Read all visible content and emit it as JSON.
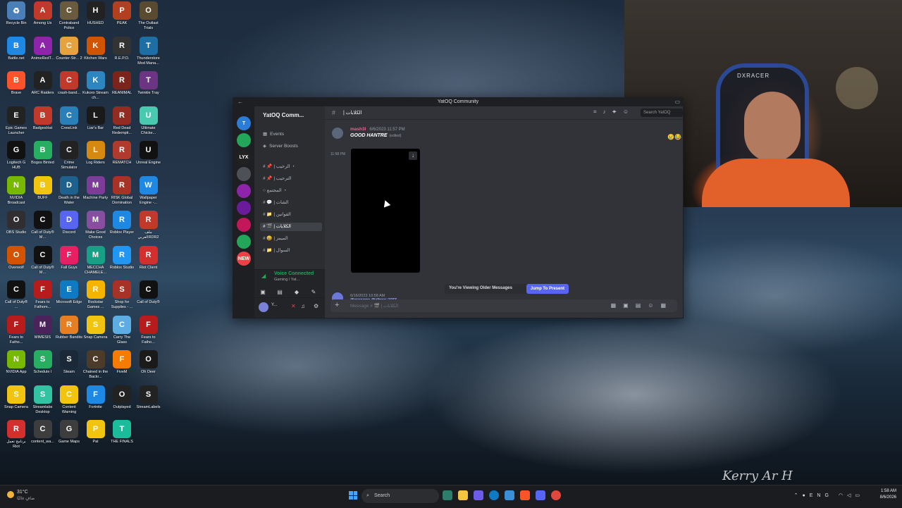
{
  "desktop": {
    "icons": [
      {
        "label": "Recycle Bin",
        "color": "#4b7fb8",
        "glyph": "♻"
      },
      {
        "label": "Among Us",
        "color": "#c0392b",
        "glyph": "A"
      },
      {
        "label": "Contraband Police",
        "color": "#6b5b3e",
        "glyph": "C"
      },
      {
        "label": "HUSHED",
        "color": "#222",
        "glyph": "H"
      },
      {
        "label": "PEAK",
        "color": "#b24020",
        "glyph": "P"
      },
      {
        "label": "The Outlast Trials",
        "color": "#5a4a30",
        "glyph": "O"
      },
      {
        "label": "Battle.net",
        "color": "#1e88e5",
        "glyph": "B"
      },
      {
        "label": "AnimeRedT...",
        "color": "#8e24aa",
        "glyph": "A"
      },
      {
        "label": "Counter-Str... 2",
        "color": "#e6a23c",
        "glyph": "C"
      },
      {
        "label": "Kitchen Wars",
        "color": "#d35400",
        "glyph": "K"
      },
      {
        "label": "R.E.P.O.",
        "color": "#333",
        "glyph": "R"
      },
      {
        "label": "Thunderstore Mod Mana...",
        "color": "#1c6ea4",
        "glyph": "T"
      },
      {
        "label": "Brave",
        "color": "#fb542b",
        "glyph": "B"
      },
      {
        "label": "ARC Raiders",
        "color": "#222",
        "glyph": "A"
      },
      {
        "label": "crash-band...",
        "color": "#c0392b",
        "glyph": "C"
      },
      {
        "label": "Kukoro Stream ch...",
        "color": "#2e86c1",
        "glyph": "K"
      },
      {
        "label": "REANIMAL",
        "color": "#7b241c",
        "glyph": "R"
      },
      {
        "label": "Twinkle Tray",
        "color": "#6c3483",
        "glyph": "T"
      },
      {
        "label": "Epic Games Launcher",
        "color": "#222",
        "glyph": "E"
      },
      {
        "label": "BadgesHat",
        "color": "#c0392b",
        "glyph": "B"
      },
      {
        "label": "CrewLink",
        "color": "#2980b9",
        "glyph": "C"
      },
      {
        "label": "Liar's Bar",
        "color": "#1a1a1a",
        "glyph": "L"
      },
      {
        "label": "Red Dead Redempti...",
        "color": "#922b21",
        "glyph": "R"
      },
      {
        "label": "Ultimate Chicke...",
        "color": "#48c9b0",
        "glyph": "U"
      },
      {
        "label": "Logitech G HUB",
        "color": "#111",
        "glyph": "G"
      },
      {
        "label": "Bogos Binted",
        "color": "#27ae60",
        "glyph": "B"
      },
      {
        "label": "Crime Simulator",
        "color": "#222",
        "glyph": "C"
      },
      {
        "label": "Log Riders",
        "color": "#d68910",
        "glyph": "L"
      },
      {
        "label": "REMATCH",
        "color": "#b03a2e",
        "glyph": "R"
      },
      {
        "label": "Unreal Engine",
        "color": "#111",
        "glyph": "U"
      },
      {
        "label": "NVIDIA Broadcast",
        "color": "#76b900",
        "glyph": "N"
      },
      {
        "label": "BUFF",
        "color": "#f1c40f",
        "glyph": "B"
      },
      {
        "label": "Death in the Water",
        "color": "#1f618d",
        "glyph": "D"
      },
      {
        "label": "Machine Party",
        "color": "#7d3c98",
        "glyph": "M"
      },
      {
        "label": "RISK Global Domination",
        "color": "#a93226",
        "glyph": "R"
      },
      {
        "label": "Wallpaper Engine -...",
        "color": "#1e88e5",
        "glyph": "W"
      },
      {
        "label": "OBS Studio",
        "color": "#302e31",
        "glyph": "O"
      },
      {
        "label": "Call of Duty® M...",
        "color": "#111",
        "glyph": "C"
      },
      {
        "label": "Discord",
        "color": "#5865f2",
        "glyph": "D"
      },
      {
        "label": "Make Good Choices",
        "color": "#884ea0",
        "glyph": "M"
      },
      {
        "label": "Roblox Player",
        "color": "#1e88e5",
        "glyph": "R"
      },
      {
        "label": "ملف العربيRDR2",
        "color": "#c0392b",
        "glyph": "R"
      },
      {
        "label": "Overwolf",
        "color": "#d35400",
        "glyph": "O"
      },
      {
        "label": "Call of Duty® M...",
        "color": "#111",
        "glyph": "C"
      },
      {
        "label": "Fall Guys",
        "color": "#e91e63",
        "glyph": "F"
      },
      {
        "label": "MECCHA CHAMELE...",
        "color": "#16a085",
        "glyph": "M"
      },
      {
        "label": "Roblox Studio",
        "color": "#2196f3",
        "glyph": "R"
      },
      {
        "label": "Riot Client",
        "color": "#d32f2f",
        "glyph": "R"
      },
      {
        "label": "Call of Duty® ...",
        "color": "#111",
        "glyph": "C"
      },
      {
        "label": "Fears to Fathom...",
        "color": "#b71c1c",
        "glyph": "F"
      },
      {
        "label": "Microsoft Edge",
        "color": "#0e7ac4",
        "glyph": "E"
      },
      {
        "label": "Rockstar Games ...",
        "color": "#f4b400",
        "glyph": "R"
      },
      {
        "label": "Shop for Supplies - ...",
        "color": "#a93226",
        "glyph": "S"
      },
      {
        "label": "Call of Duty®",
        "color": "#111",
        "glyph": "C"
      },
      {
        "label": "Fears to Fatho...",
        "color": "#b71c1c",
        "glyph": "F"
      },
      {
        "label": "MIMESIS",
        "color": "#4a235a",
        "glyph": "M"
      },
      {
        "label": "Rubber Bandits",
        "color": "#e67e22",
        "glyph": "R"
      },
      {
        "label": "Snap Camera",
        "color": "#f1c40f",
        "glyph": "S"
      },
      {
        "label": "Carry The Glass",
        "color": "#5dade2",
        "glyph": "C"
      },
      {
        "label": "Fears to Fatho...",
        "color": "#b71c1c",
        "glyph": "F"
      },
      {
        "label": "NVIDIA App",
        "color": "#76b900",
        "glyph": "N"
      },
      {
        "label": "Schedule I",
        "color": "#27ae60",
        "glyph": "S"
      },
      {
        "label": "Steam",
        "color": "#1b2838",
        "glyph": "S"
      },
      {
        "label": "Chained in the Backr...",
        "color": "#4d3b2a",
        "glyph": "C"
      },
      {
        "label": "FiveM",
        "color": "#f57c00",
        "glyph": "F"
      },
      {
        "label": "Oh Deer",
        "color": "#1a1a1a",
        "glyph": "O"
      },
      {
        "label": "Snap Camera",
        "color": "#f1c40f",
        "glyph": "S"
      },
      {
        "label": "Streamlabs Desktop",
        "color": "#31c3a2",
        "glyph": "S"
      },
      {
        "label": "Content Warning",
        "color": "#f1c40f",
        "glyph": "C"
      },
      {
        "label": "Fortnite",
        "color": "#1e88e5",
        "glyph": "F"
      },
      {
        "label": "Outplayed",
        "color": "#222",
        "glyph": "O"
      },
      {
        "label": "StreamLabels",
        "color": "#222",
        "glyph": "S"
      },
      {
        "label": "برنامج تعمل Riot",
        "color": "#d32f2f",
        "glyph": "R"
      },
      {
        "label": "content_wa...",
        "color": "#3d3d3d",
        "glyph": "C"
      },
      {
        "label": "Game Maps",
        "color": "#3d3d3d",
        "glyph": "G"
      },
      {
        "label": "Pal",
        "color": "#f1c40f",
        "glyph": "P"
      },
      {
        "label": "THE FINALS",
        "color": "#1abc9c",
        "glyph": "T"
      }
    ]
  },
  "webcam": {
    "chair_brand": "DXRACER"
  },
  "discord": {
    "window_title": "YatOQ Community",
    "server_name": "YatOQ Comm...",
    "servers": [
      {
        "label": "T",
        "color": "#2b7bd9"
      },
      {
        "label": "",
        "color": "#23a55a"
      },
      {
        "label": "LYX",
        "color": "#222"
      },
      {
        "label": "",
        "color": "#4e5058"
      },
      {
        "label": "",
        "color": "#8e24aa"
      },
      {
        "label": "",
        "color": "#6a1b9a"
      },
      {
        "label": "",
        "color": "#c2185b"
      },
      {
        "label": "",
        "color": "#23a55a"
      },
      {
        "label": "NEW",
        "color": "#ed4245"
      }
    ],
    "channel_items": [
      {
        "label": "Events",
        "icon": "▦"
      },
      {
        "label": "Server Boosts",
        "icon": "◈"
      },
      {
        "label": "# 📌 | الرحيب ・",
        "icon": ""
      },
      {
        "label": "# 📌 | الترحيب",
        "icon": ""
      },
      {
        "label": "○ المجتمع ・",
        "icon": ""
      },
      {
        "label": "# 💬 | الشات",
        "icon": ""
      },
      {
        "label": "# 📁 | القوانين",
        "icon": ""
      },
      {
        "label": "# 🎬 | الكلابات",
        "icon": ""
      },
      {
        "label": "# 😄 | الميمز",
        "icon": ""
      },
      {
        "label": "# 📁 | السوال",
        "icon": ""
      }
    ],
    "active_channel_index": 7,
    "voice_status": "Voice Connected",
    "voice_sub": "Gaming / Yat...",
    "user_name": "Y...",
    "channel_name": "| الكلابات",
    "search_placeholder": "Search YatOQ",
    "message1": {
      "author": "mash3l",
      "timestamp": "6/6/2023 11:57 PM",
      "text": "GOOD HANTRE",
      "edited": "(edited)",
      "side_time": "11:58 PM"
    },
    "reactions": "😢😂",
    "jump_text": "You're Viewing Older Messages",
    "jump_button": "Jump To Present",
    "message2": {
      "timestamp": "6/16/2023 10:58 AM",
      "mention1": "@everyone",
      "text": "@alhraa_1077"
    },
    "composer_placeholder": "Message # 🎬 | الكلابات"
  },
  "taskbar": {
    "temperature": "31°C",
    "condition": "صافٍ غالبًا",
    "search_placeholder": "Search",
    "time": "1:58 AM",
    "date": "8/6/2026",
    "lang": "ENG"
  },
  "signature": "Kerry Ar H"
}
